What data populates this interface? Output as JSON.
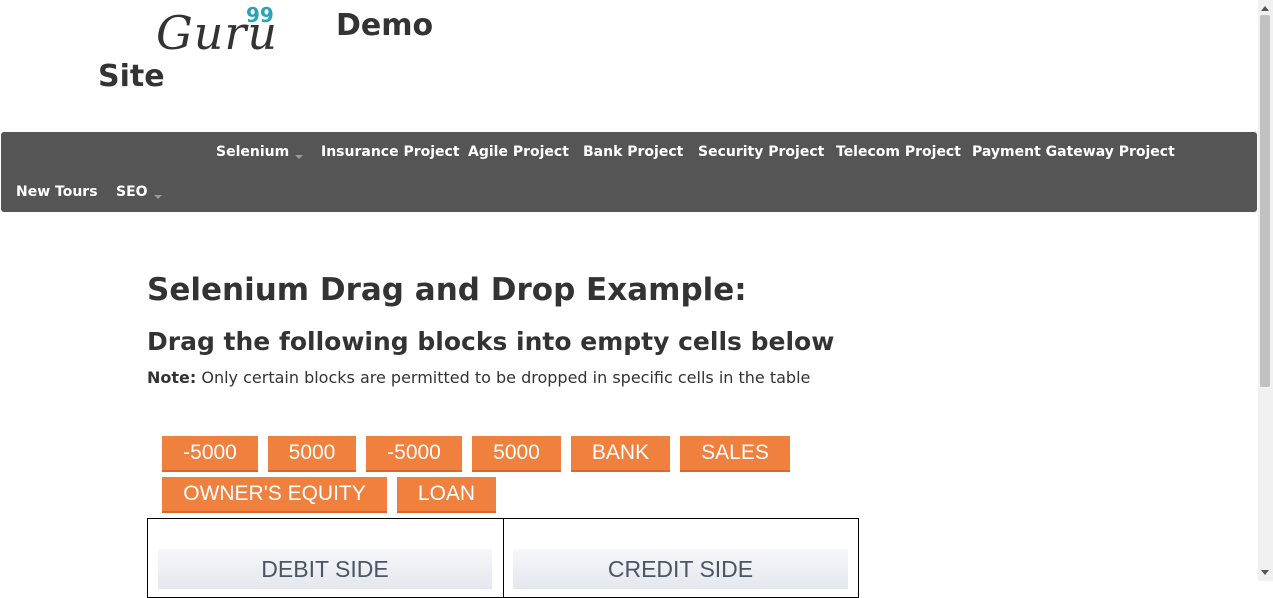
{
  "logo": {
    "brand": "Guru",
    "superscript": "99",
    "word1": "Demo",
    "word2": "Site"
  },
  "nav": {
    "row1": [
      {
        "label": "Selenium",
        "dropdown": true
      },
      {
        "label": "Insurance Project"
      },
      {
        "label": "Agile Project"
      },
      {
        "label": "Bank Project"
      },
      {
        "label": "Security Project"
      },
      {
        "label": "Telecom Project"
      },
      {
        "label": "Payment Gateway Project"
      }
    ],
    "row2": [
      {
        "label": "New Tours"
      },
      {
        "label": "SEO",
        "dropdown": true
      }
    ]
  },
  "main": {
    "title": "Selenium Drag and Drop Example:",
    "subtitle": "Drag the following blocks into empty cells below",
    "note_label": "Note:",
    "note_text": " Only certain blocks are permitted to be dropped in specific cells in the table"
  },
  "blocks": [
    "-5000",
    "5000",
    "-5000",
    "5000",
    "BANK",
    "SALES",
    "OWNER'S EQUITY",
    "LOAN"
  ],
  "table": {
    "debit_heading": "DEBIT SIDE",
    "credit_heading": "CREDIT SIDE"
  },
  "colors": {
    "navbar": "#555555",
    "block": "#f0803e",
    "logo_accent": "#2aa3b8"
  }
}
